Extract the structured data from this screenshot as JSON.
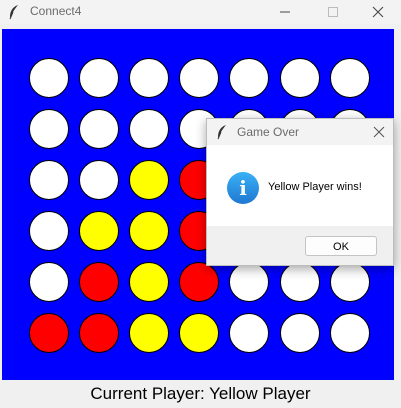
{
  "window": {
    "title": "Connect4",
    "app_icon": "feather-icon",
    "controls": [
      "minimize-icon",
      "maximize-icon",
      "close-icon"
    ]
  },
  "board": {
    "rows": 6,
    "cols": 7,
    "background": "#0000ff",
    "piece_colors": {
      "empty": "#ffffff",
      "red": "#ff0000",
      "yellow": "#ffff00"
    },
    "cells": [
      [
        "empty",
        "empty",
        "empty",
        "empty",
        "empty",
        "empty",
        "empty"
      ],
      [
        "empty",
        "empty",
        "empty",
        "empty",
        "empty",
        "empty",
        "empty"
      ],
      [
        "empty",
        "empty",
        "yellow",
        "red",
        "empty",
        "empty",
        "empty"
      ],
      [
        "empty",
        "yellow",
        "yellow",
        "red",
        "empty",
        "empty",
        "empty"
      ],
      [
        "empty",
        "red",
        "yellow",
        "red",
        "empty",
        "empty",
        "empty"
      ],
      [
        "red",
        "red",
        "yellow",
        "yellow",
        "empty",
        "empty",
        "empty"
      ]
    ]
  },
  "status": {
    "text": "Current Player: Yellow Player"
  },
  "dialog": {
    "title": "Game Over",
    "icon": "info-icon",
    "message": "Yellow Player wins!",
    "ok_label": "OK"
  }
}
